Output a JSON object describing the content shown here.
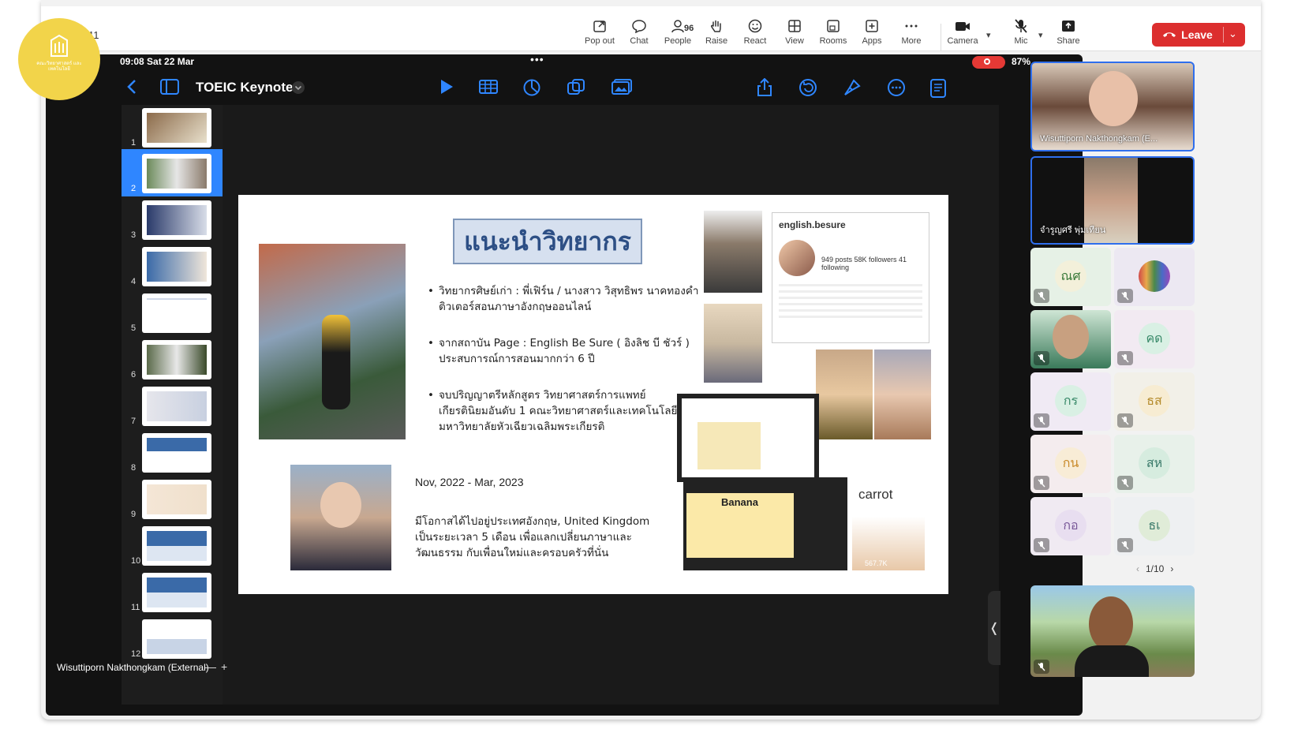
{
  "topbar": {
    "left_time": "11",
    "buttons": [
      {
        "label": "Pop out",
        "icon": "pop-out-icon"
      },
      {
        "label": "Chat",
        "icon": "chat-icon"
      },
      {
        "label": "People",
        "icon": "people-icon",
        "count": "96"
      },
      {
        "label": "Raise",
        "icon": "raise-hand-icon"
      },
      {
        "label": "React",
        "icon": "react-icon"
      },
      {
        "label": "View",
        "icon": "view-icon"
      },
      {
        "label": "Rooms",
        "icon": "rooms-icon"
      },
      {
        "label": "Apps",
        "icon": "apps-icon"
      },
      {
        "label": "More",
        "icon": "more-icon"
      },
      {
        "label": "Camera",
        "icon": "camera-icon"
      },
      {
        "label": "Mic",
        "icon": "mic-off-icon"
      },
      {
        "label": "Share",
        "icon": "share-icon"
      }
    ],
    "leave_label": "Leave",
    "leave_color": "#dc2e2e"
  },
  "share": {
    "status_time": "09:08  Sat 22 Mar",
    "status_dots": "•••",
    "battery": "87%",
    "app_title": "TOEIC Keynote",
    "thumbnails": [
      "1",
      "2",
      "3",
      "4",
      "5",
      "6",
      "7",
      "8",
      "9",
      "10",
      "11",
      "12"
    ],
    "selected_thumbnail": "2",
    "slide": {
      "title": "แนะนำวิทยากร",
      "bullets": [
        [
          "วิทยากรศิษย์เก่า : พี่เฟิร์น / นางสาว วิสุทธิพร นาคทองคำ",
          "ติวเตอร์สอนภาษาอังกฤษออนไลน์"
        ],
        [
          "จากสถาบัน Page : English Be Sure ( อิงลิช บี ชัวร์ )",
          "ประสบการณ์การสอนมากกว่า 6 ปี"
        ],
        [
          "จบปริญญาตรีหลักสูตร วิทยาศาสตร์การแพทย์",
          "เกียรตินิยมอันดับ 1 คณะวิทยาศาสตร์และเทคโนโลยี",
          "มหาวิทยาลัยหัวเฉียวเฉลิมพระเกียรติ"
        ]
      ],
      "date": "Nov, 2022 - Mar, 2023",
      "desc": "มีโอกาสได้ไปอยู่ประเทศอังกฤษ, United Kingdom เป็นระยะเวลา 5 เดือน เพื่อแลกเปลี่ยนภาษาและวัฒนธรรม กับเพื่อนใหม่และครอบครัวที่นั่น",
      "ig_name": "english.besure",
      "ig_stats": "949 posts   58K followers   41 following",
      "banana_label": "Banana",
      "carrot_label": "carrot",
      "views": "567.7K"
    },
    "speaker_name": "Wisuttiporn Nakthongkam (External)",
    "speaker_minus": "—",
    "speaker_plus": "+"
  },
  "logo": {
    "text": "คณะวิทยาศาสตร์ และเทคโนโลยี"
  },
  "gallery": {
    "video_tiles": [
      {
        "name": "Wisuttiporn Nakthongkam (E..."
      },
      {
        "name": "จำรูญศรี พุ่มเทียน"
      }
    ],
    "tiles": [
      {
        "initials": "ณศ",
        "bg": "#e6f1e6",
        "fg": "#3a7a3a",
        "ring": "#f3f0da"
      },
      {
        "initials": "",
        "bg": "#ece8f2",
        "fg": "#555",
        "ring": "#7a9cc9",
        "image": true
      },
      {
        "initials": "",
        "bg": "#e8f3ea",
        "fg": "#555",
        "ring": "#cfe6d5",
        "photo": true
      },
      {
        "initials": "คด",
        "bg": "#f2eaf2",
        "fg": "#3a8a6a",
        "ring": "#d9f0e4"
      },
      {
        "initials": "กร",
        "bg": "#f0eaf4",
        "fg": "#3a8a6a",
        "ring": "#d9f0e4"
      },
      {
        "initials": "ธส",
        "bg": "#f2f0e8",
        "fg": "#b48a2a",
        "ring": "#f7ecd2"
      },
      {
        "initials": "กน",
        "bg": "#f4ecee",
        "fg": "#c98a2a",
        "ring": "#f8ecd6"
      },
      {
        "initials": "สห",
        "bg": "#e8f1ea",
        "fg": "#3a7a6a",
        "ring": "#d6ecdf"
      },
      {
        "initials": "กอ",
        "bg": "#f0eaf2",
        "fg": "#7a5a9a",
        "ring": "#e8def0"
      },
      {
        "initials": "ธเ",
        "bg": "#eef0f2",
        "fg": "#3a7a6a",
        "ring": "#e0ecd8"
      }
    ],
    "pager": "1/10"
  }
}
